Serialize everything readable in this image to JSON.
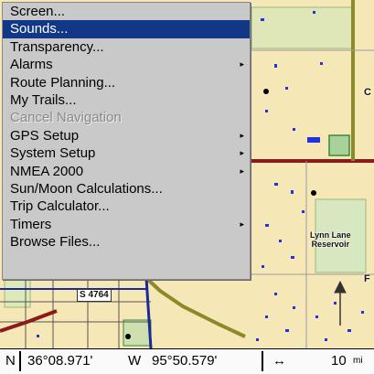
{
  "menu": {
    "items": [
      {
        "label": "Screen...",
        "has_submenu": false,
        "selected": false,
        "disabled": false
      },
      {
        "label": "Sounds...",
        "has_submenu": false,
        "selected": true,
        "disabled": false
      },
      {
        "label": "Transparency...",
        "has_submenu": false,
        "selected": false,
        "disabled": false
      },
      {
        "label": "Alarms",
        "has_submenu": true,
        "selected": false,
        "disabled": false
      },
      {
        "label": "Route Planning...",
        "has_submenu": false,
        "selected": false,
        "disabled": false
      },
      {
        "label": "My Trails...",
        "has_submenu": false,
        "selected": false,
        "disabled": false
      },
      {
        "label": "Cancel Navigation",
        "has_submenu": false,
        "selected": false,
        "disabled": true
      },
      {
        "label": "GPS Setup",
        "has_submenu": true,
        "selected": false,
        "disabled": false
      },
      {
        "label": "System Setup",
        "has_submenu": true,
        "selected": false,
        "disabled": false
      },
      {
        "label": "NMEA 2000",
        "has_submenu": true,
        "selected": false,
        "disabled": false
      },
      {
        "label": "Sun/Moon Calculations...",
        "has_submenu": false,
        "selected": false,
        "disabled": false
      },
      {
        "label": "Trip Calculator...",
        "has_submenu": false,
        "selected": false,
        "disabled": false
      },
      {
        "label": "Timers",
        "has_submenu": true,
        "selected": false,
        "disabled": false
      },
      {
        "label": "Browse Files...",
        "has_submenu": false,
        "selected": false,
        "disabled": false
      }
    ],
    "submenu_arrow": "▸",
    "selected_color": "#123787"
  },
  "map": {
    "labels": {
      "east_c": "C",
      "east_f": "F",
      "reservoir_line1": "Lynn Lane",
      "reservoir_line2": "Reservoir",
      "road_shield": "S 4764"
    },
    "colors": {
      "land": "#f6e7b6",
      "park": "#c8dca6",
      "road_major": "#8b1a1a",
      "road_olive": "#8a8a2a",
      "road_blue": "#1a2a9a",
      "water": "#2233dd"
    }
  },
  "status_bar": {
    "lat_hemisphere": "N",
    "latitude": "36°08.971'",
    "lon_hemisphere": "W",
    "longitude": "95°50.579'",
    "scale_icon": "↔",
    "scale_value": "10",
    "scale_unit": "mi"
  }
}
